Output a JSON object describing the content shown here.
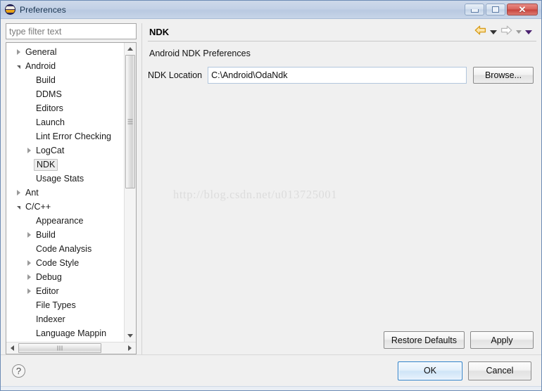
{
  "window": {
    "title": "Preferences",
    "icon": "eclipse-icon",
    "controls": {
      "minimize": "minimize-icon",
      "maximize": "maximize-icon",
      "close": "✕"
    }
  },
  "sidebar": {
    "filter": {
      "value": "",
      "placeholder": "type filter text"
    },
    "tree": [
      {
        "label": "General",
        "level": 0,
        "state": "collapsed",
        "selected": false
      },
      {
        "label": "Android",
        "level": 0,
        "state": "expanded",
        "selected": false
      },
      {
        "label": "Build",
        "level": 2,
        "state": "leaf",
        "selected": false
      },
      {
        "label": "DDMS",
        "level": 2,
        "state": "leaf",
        "selected": false
      },
      {
        "label": "Editors",
        "level": 2,
        "state": "leaf",
        "selected": false
      },
      {
        "label": "Launch",
        "level": 2,
        "state": "leaf",
        "selected": false
      },
      {
        "label": "Lint Error Checking",
        "level": 2,
        "state": "leaf",
        "selected": false
      },
      {
        "label": "LogCat",
        "level": 1,
        "state": "collapsed",
        "selected": false
      },
      {
        "label": "NDK",
        "level": 2,
        "state": "leaf",
        "selected": true
      },
      {
        "label": "Usage Stats",
        "level": 2,
        "state": "leaf",
        "selected": false
      },
      {
        "label": "Ant",
        "level": 0,
        "state": "collapsed",
        "selected": false
      },
      {
        "label": "C/C++",
        "level": 0,
        "state": "expanded",
        "selected": false
      },
      {
        "label": "Appearance",
        "level": 2,
        "state": "leaf",
        "selected": false
      },
      {
        "label": "Build",
        "level": 1,
        "state": "collapsed",
        "selected": false
      },
      {
        "label": "Code Analysis",
        "level": 2,
        "state": "leaf",
        "selected": false
      },
      {
        "label": "Code Style",
        "level": 1,
        "state": "collapsed",
        "selected": false
      },
      {
        "label": "Debug",
        "level": 1,
        "state": "collapsed",
        "selected": false
      },
      {
        "label": "Editor",
        "level": 1,
        "state": "collapsed",
        "selected": false
      },
      {
        "label": "File Types",
        "level": 2,
        "state": "leaf",
        "selected": false
      },
      {
        "label": "Indexer",
        "level": 2,
        "state": "leaf",
        "selected": false
      },
      {
        "label": "Language Mappin",
        "level": 2,
        "state": "leaf",
        "selected": false
      }
    ],
    "scroll": {
      "vertical_icon_up": "scroll-up-icon",
      "vertical_icon_down": "scroll-down-icon",
      "horizontal_icon_left": "scroll-left-icon",
      "horizontal_icon_right": "scroll-right-icon"
    }
  },
  "page": {
    "title": "NDK",
    "description": "Android NDK Preferences",
    "nav": {
      "back_icon": "back-arrow-icon",
      "back_menu_icon": "chevron-down-icon",
      "forward_icon": "forward-arrow-icon",
      "forward_menu_icon": "chevron-down-icon",
      "more_menu_icon": "chevron-down-icon"
    },
    "ndk_location": {
      "label": "NDK Location",
      "value": "C:\\Android\\OdaNdk",
      "placeholder": ""
    },
    "browse_label": "Browse...",
    "restore_defaults_label": "Restore Defaults",
    "apply_label": "Apply",
    "watermark": "http://blog.csdn.net/u013725001"
  },
  "footer": {
    "help_icon": "?",
    "ok_label": "OK",
    "cancel_label": "Cancel"
  },
  "colors": {
    "titlebar": "#c3d1e6",
    "window_border": "#6d8cb5",
    "dialog_background": "#f0f0f0",
    "close_button": "#c6423b",
    "ok_button_border": "#2a7fc9",
    "back_arrow": "#e8a317",
    "forward_arrow": "#bdbdbd",
    "selection": "#ededed",
    "watermark": "#dcdcdc",
    "field_border": "#b2c7dd"
  }
}
